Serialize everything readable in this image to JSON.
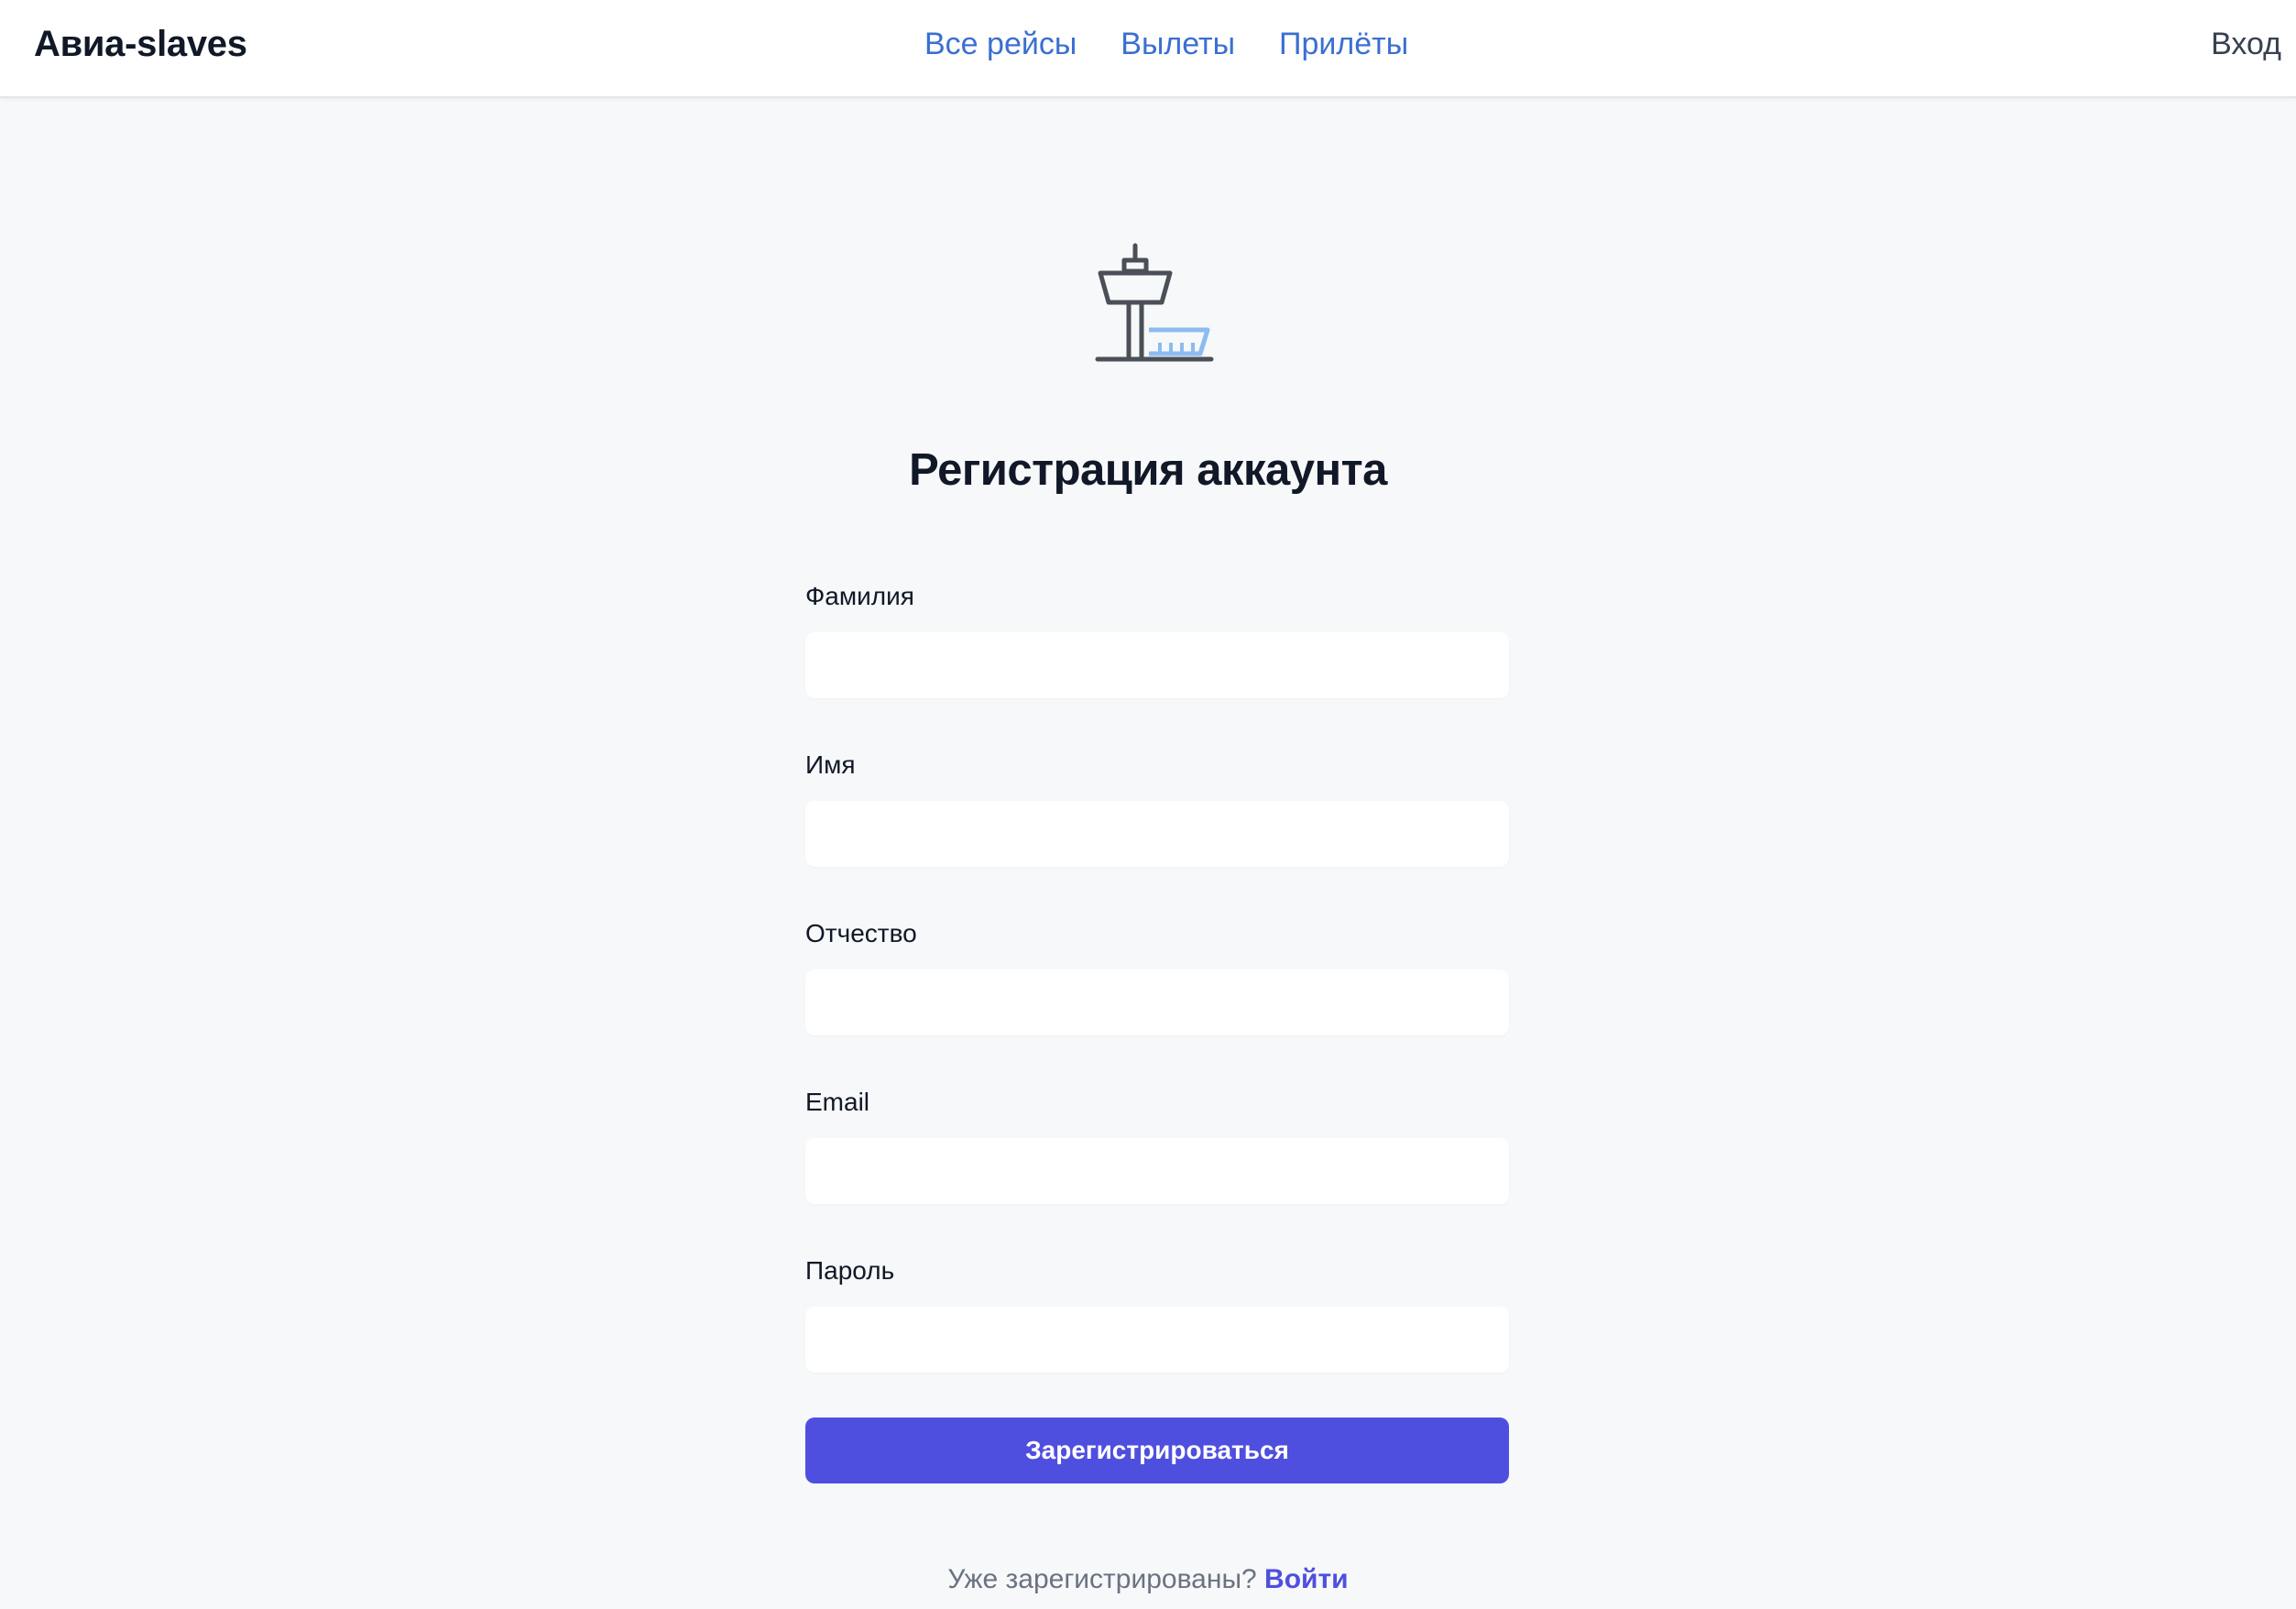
{
  "header": {
    "brand": "Авиа-slaves",
    "nav": [
      {
        "label": "Все рейсы"
      },
      {
        "label": "Вылеты"
      },
      {
        "label": "Прилёты"
      }
    ],
    "login_label": "Вход"
  },
  "logo": {
    "icon": "control-tower-icon",
    "colors": {
      "stroke": "#4b4f57",
      "accent": "#8cbcf0"
    }
  },
  "page_title": "Регистрация аккаунта",
  "form": {
    "fields": [
      {
        "label": "Фамилия",
        "value": ""
      },
      {
        "label": "Имя",
        "value": ""
      },
      {
        "label": "Отчество",
        "value": ""
      },
      {
        "label": "Email",
        "value": ""
      },
      {
        "label": "Пароль",
        "value": ""
      }
    ],
    "submit_label": "Зарегистрироваться"
  },
  "footer": {
    "prompt": "Уже зарегистрированы?",
    "link_label": "Войти"
  },
  "colors": {
    "accent": "#4f4fdf",
    "nav_link": "#3b6fd1",
    "background": "#f6f8f9"
  }
}
